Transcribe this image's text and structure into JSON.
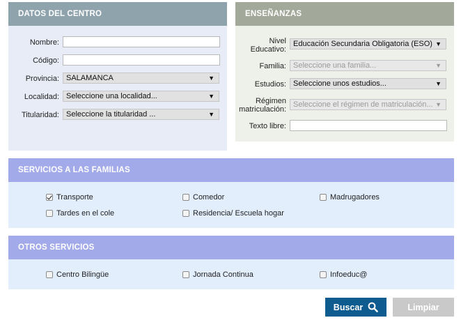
{
  "datos_centro": {
    "header": "DATOS DEL CENTRO",
    "nombre_label": "Nombre:",
    "nombre_value": "",
    "codigo_label": "Código:",
    "codigo_value": "",
    "provincia_label": "Provincia:",
    "provincia_value": "SALAMANCA",
    "localidad_label": "Localidad:",
    "localidad_value": "Seleccione una localidad...",
    "titularidad_label": "Titularidad:",
    "titularidad_value": "Seleccione la titularidad ..."
  },
  "ensenanzas": {
    "header": "ENSEÑANZAS",
    "nivel_label_1": "Nivel",
    "nivel_label_2": "Educativo:",
    "nivel_value": "Educación Secundaria Obligatoria (ESO)",
    "familia_label": "Familia:",
    "familia_value": "Seleccione una familia...",
    "estudios_label": "Estudios:",
    "estudios_value": "Seleccione unos estudios...",
    "regimen_label_1": "Régimen",
    "regimen_label_2": "matriculación:",
    "regimen_value": "Seleccione el régimen de matriculación...",
    "texto_label": "Texto libre:",
    "texto_value": ""
  },
  "servicios_familias": {
    "header": "SERVICIOS A LAS FAMILIAS",
    "items": [
      {
        "label": "Transporte",
        "checked": true
      },
      {
        "label": "Comedor",
        "checked": false
      },
      {
        "label": "Madrugadores",
        "checked": false
      },
      {
        "label": "Tardes en el cole",
        "checked": false
      },
      {
        "label": "Residencia/ Escuela hogar",
        "checked": false
      }
    ]
  },
  "otros_servicios": {
    "header": "OTROS SERVICIOS",
    "items": [
      {
        "label": "Centro Bilingüe",
        "checked": false
      },
      {
        "label": "Jornada Continua",
        "checked": false
      },
      {
        "label": "Infoeduc@",
        "checked": false
      }
    ]
  },
  "actions": {
    "buscar_label": "Buscar",
    "limpiar_label": "Limpiar",
    "search_icon": "search-icon"
  },
  "colors": {
    "datos_header": "#8fa3ad",
    "datos_body": "#e7ecf6",
    "ensenanzas_header": "#a2a89a",
    "ensenanzas_body": "#eef0ea",
    "servicios_header": "#a3aaea",
    "servicios_body": "#e3eefd",
    "buscar_bg": "#0e5c8f",
    "limpiar_bg": "#c9c9c9"
  }
}
